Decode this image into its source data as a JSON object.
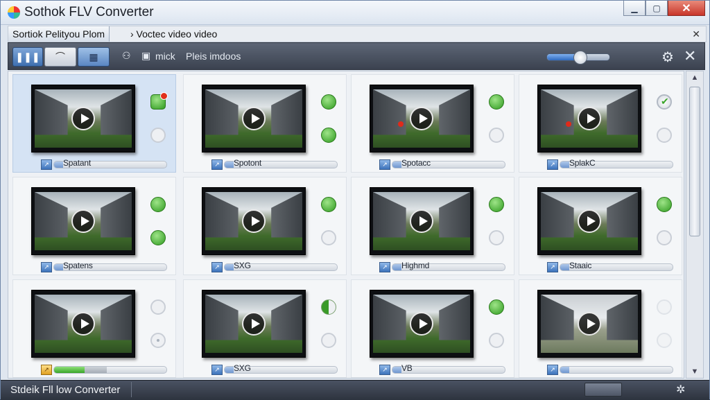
{
  "window": {
    "title": "Sothok FLV Converter",
    "minimize": "▁",
    "maximize": "▢",
    "close": "✕"
  },
  "tabbar": {
    "active_tab": "Sortiok Pelityou Plom",
    "path": "› Voctec  video video",
    "close": "✕"
  },
  "toolbar": {
    "view_grid": "❚❚❚",
    "view_list": "⌒",
    "view_tiles": "▦",
    "person_icon": "⚇",
    "mick_label": "mick",
    "media_icon": "▣",
    "plex_label": "Pleis imdoos",
    "zoom_level": 0.52,
    "gear": "⚙",
    "close": "✕"
  },
  "items": [
    {
      "label": "Spatant",
      "progress": 0.0,
      "status_top": "green-alert",
      "status_bottom": "empty",
      "selected": true
    },
    {
      "label": "Spotont",
      "progress": 0.0,
      "status_top": "green",
      "status_bottom": "green",
      "selected": false
    },
    {
      "label": "Spotacc",
      "progress": 0.0,
      "status_top": "green",
      "status_bottom": "empty",
      "selected": false
    },
    {
      "label": "SplakC",
      "progress": 0.0,
      "status_top": "check",
      "status_bottom": "empty",
      "selected": false
    },
    {
      "label": "Spatens",
      "progress": 0.0,
      "status_top": "green",
      "status_bottom": "green",
      "selected": false
    },
    {
      "label": "SXG",
      "progress": 0.0,
      "status_top": "green",
      "status_bottom": "empty",
      "selected": false
    },
    {
      "label": "Highmd",
      "progress": 0.0,
      "status_top": "green",
      "status_bottom": "empty",
      "selected": false
    },
    {
      "label": "Staaic",
      "progress": 0.0,
      "status_top": "green",
      "status_bottom": "empty",
      "selected": false
    },
    {
      "label": "",
      "progress": 0.27,
      "status_top": "empty",
      "status_bottom": "target",
      "selected": false
    },
    {
      "label": "SXG",
      "progress": 0.0,
      "status_top": "half",
      "status_bottom": "empty",
      "selected": false
    },
    {
      "label": "VB",
      "progress": 0.0,
      "status_top": "green",
      "status_bottom": "empty",
      "selected": false
    },
    {
      "label": "",
      "progress": 0.0,
      "status_top": "dim",
      "status_bottom": "dim",
      "selected": false
    }
  ],
  "statusbar": {
    "text": "Stdeik  Fll  low  Converter",
    "gear": "✲"
  },
  "colors": {
    "accent": "#3e6fb0",
    "success": "#2f9a1f",
    "alert": "#e02a1a"
  }
}
